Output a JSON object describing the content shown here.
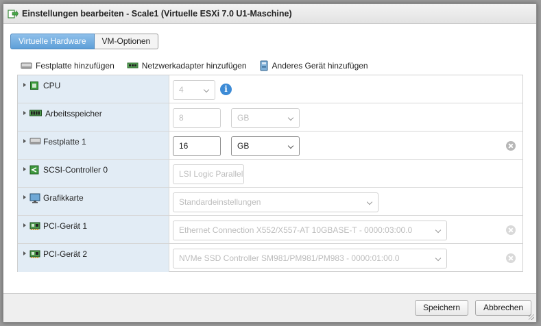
{
  "dialog": {
    "title": "Einstellungen bearbeiten - Scale1 (Virtuelle ESXi 7.0 U1-Maschine)"
  },
  "tabs": [
    {
      "label": "Virtuelle Hardware",
      "active": true
    },
    {
      "label": "VM-Optionen",
      "active": false
    }
  ],
  "toolbar": {
    "add_disk": "Festplatte hinzufügen",
    "add_nic": "Netzwerkadapter hinzufügen",
    "add_other": "Anderes Gerät hinzufügen"
  },
  "devices": {
    "cpu": {
      "label": "CPU",
      "value": "4",
      "icon": "cpu-chip-icon"
    },
    "memory": {
      "label": "Arbeitsspeicher",
      "value": "8",
      "unit": "GB",
      "icon": "ram-module-icon"
    },
    "disk1": {
      "label": "Festplatte 1",
      "value": "16",
      "unit": "GB",
      "icon": "hard-disk-icon"
    },
    "scsi0": {
      "label": "SCSI-Controller 0",
      "value": "LSI Logic Parallel",
      "icon": "scsi-controller-icon"
    },
    "video": {
      "label": "Grafikkarte",
      "value": "Standardeinstellungen",
      "icon": "monitor-icon"
    },
    "pci1": {
      "label": "PCI-Gerät 1",
      "value": "Ethernet Connection X552/X557-AT 10GBASE-T - 0000:03:00.0",
      "icon": "pci-card-icon"
    },
    "pci2": {
      "label": "PCI-Gerät 2",
      "value": "NVMe SSD Controller SM981/PM981/PM983 - 0000:01:00.0",
      "icon": "pci-card-icon"
    }
  },
  "footer": {
    "save": "Speichern",
    "cancel": "Abbrechen"
  },
  "colors": {
    "accent": "#5e9fd8",
    "label_column_bg": "#e2ecf5",
    "info_icon": "#3d8bd6"
  }
}
